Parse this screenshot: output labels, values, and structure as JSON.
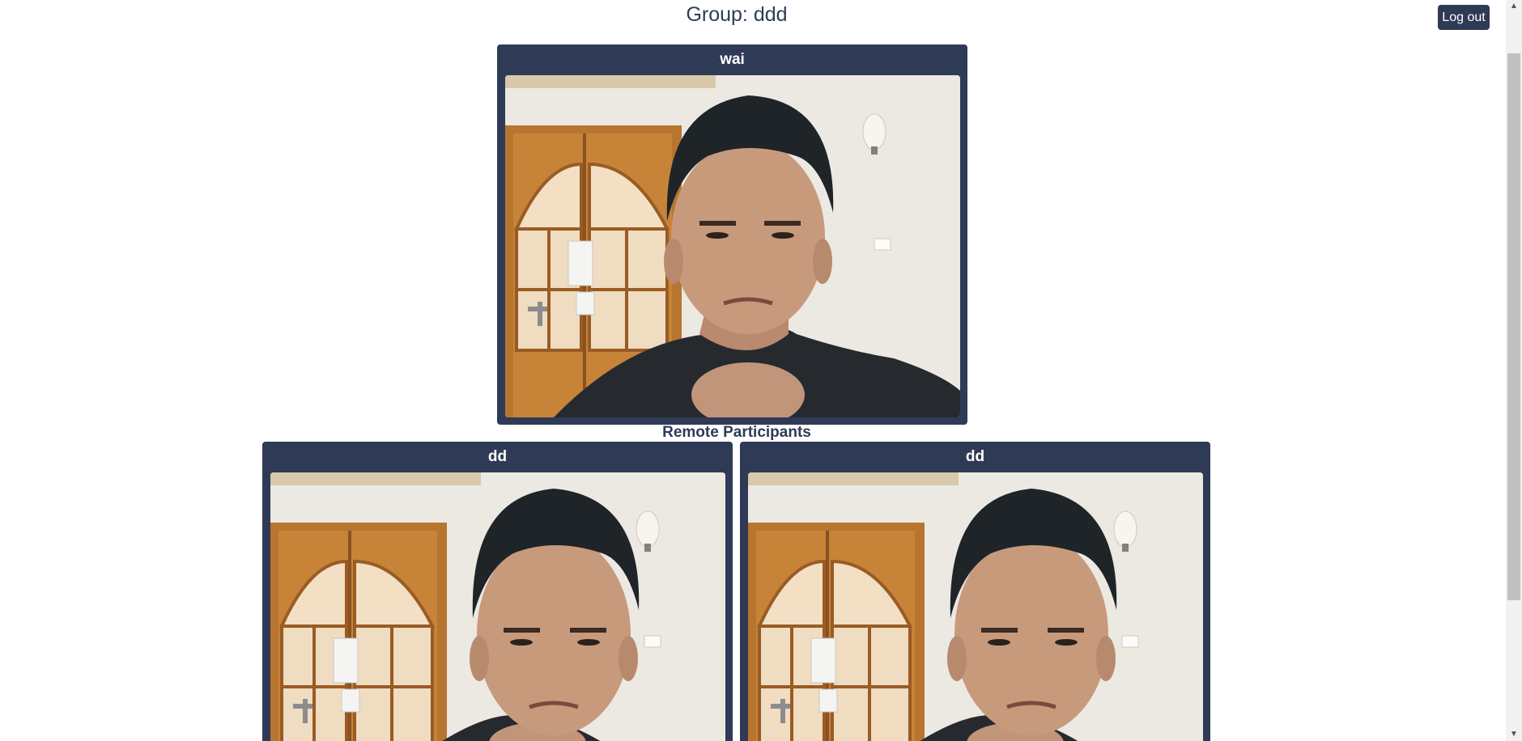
{
  "header": {
    "title": "Group: ddd",
    "logout_label": "Log out"
  },
  "local_participant": {
    "name": "wai"
  },
  "remote_section": {
    "label": "Remote Participants",
    "participants": [
      {
        "name": "dd"
      },
      {
        "name": "dd"
      }
    ]
  },
  "icons": {
    "scroll_up": "scroll-up-arrow-icon",
    "scroll_down": "scroll-down-arrow-icon"
  },
  "colors": {
    "accent": "#2f3a56",
    "text": "#2f3b57",
    "background": "#ffffff"
  }
}
